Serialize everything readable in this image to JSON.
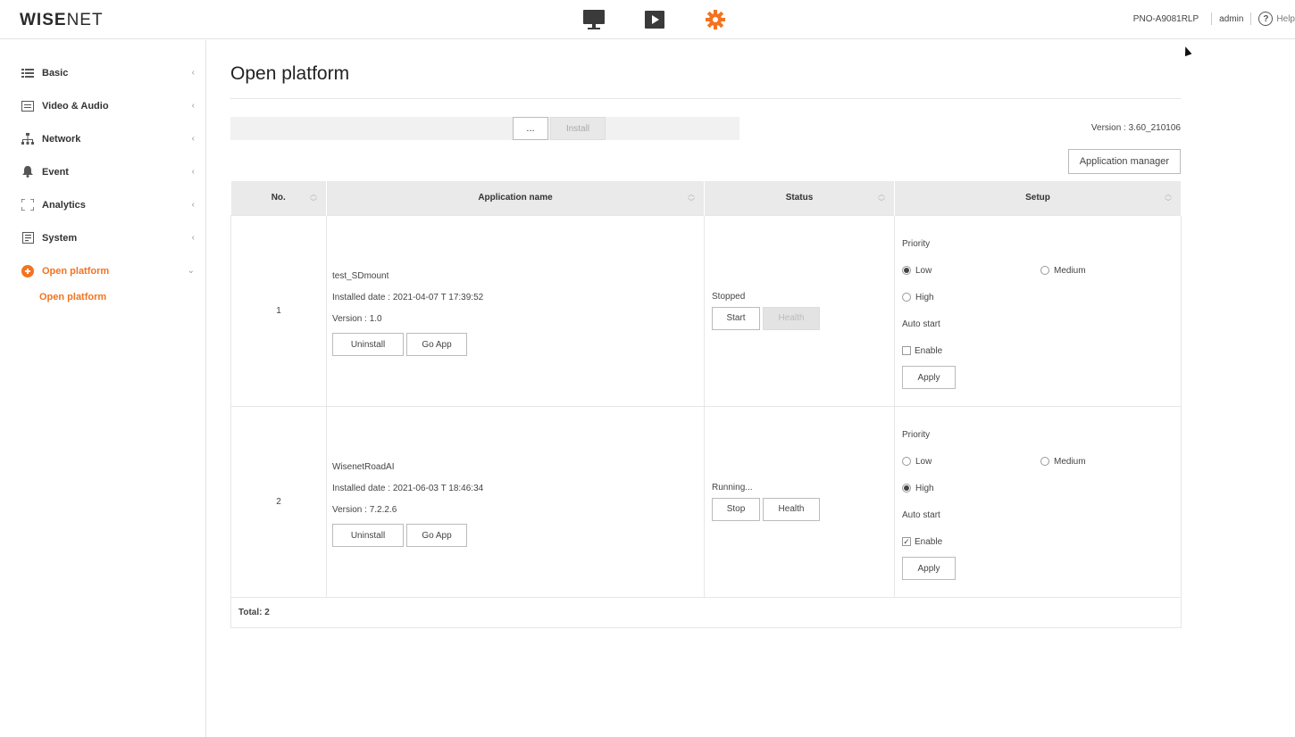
{
  "header": {
    "logo_bold": "WISE",
    "logo_light": "NET",
    "nav": [
      {
        "name": "live-view-icon"
      },
      {
        "name": "playback-icon"
      },
      {
        "name": "settings-gear-icon",
        "active": true
      }
    ],
    "model": "PNO-A9081RLP",
    "user": "admin",
    "help_label": "Help"
  },
  "sidebar": {
    "items": [
      {
        "label": "Basic",
        "icon": "basic-list-icon"
      },
      {
        "label": "Video & Audio",
        "icon": "video-audio-icon"
      },
      {
        "label": "Network",
        "icon": "network-icon"
      },
      {
        "label": "Event",
        "icon": "event-bell-icon"
      },
      {
        "label": "Analytics",
        "icon": "analytics-icon"
      },
      {
        "label": "System",
        "icon": "system-icon"
      },
      {
        "label": "Open platform",
        "icon": "open-platform-icon",
        "active": true
      }
    ],
    "sub_items": [
      {
        "label": "Open platform"
      }
    ]
  },
  "main": {
    "title": "Open platform",
    "browse_label": "...",
    "install_label": "Install",
    "version": "Version : 3.60_210106",
    "app_manager_label": "Application manager",
    "columns": [
      "No.",
      "Application name",
      "Status",
      "Setup"
    ],
    "rows": [
      {
        "no": "1",
        "name": "test_SDmount",
        "installed": "Installed date : 2021-04-07 T 17:39:52",
        "version": "Version : 1.0",
        "uninstall_label": "Uninstall",
        "goapp_label": "Go App",
        "status": "Stopped",
        "action_label": "Start",
        "health_label": "Health",
        "priority_label": "Priority",
        "low_label": "Low",
        "medium_label": "Medium",
        "high_label": "High",
        "priority": "low",
        "autostart_label": "Auto start",
        "enable_label": "Enable",
        "enabled": false,
        "apply_label": "Apply"
      },
      {
        "no": "2",
        "name": "WisenetRoadAI",
        "installed": "Installed date : 2021-06-03 T 18:46:34",
        "version": "Version : 7.2.2.6",
        "uninstall_label": "Uninstall",
        "goapp_label": "Go App",
        "status": "Running...",
        "action_label": "Stop",
        "health_label": "Health",
        "priority_label": "Priority",
        "low_label": "Low",
        "medium_label": "Medium",
        "high_label": "High",
        "priority": "high",
        "autostart_label": "Auto start",
        "enable_label": "Enable",
        "enabled": true,
        "apply_label": "Apply"
      }
    ],
    "total": "Total: 2"
  },
  "colors": {
    "accent": "#f37321",
    "header_bg": "#eaeaea"
  }
}
